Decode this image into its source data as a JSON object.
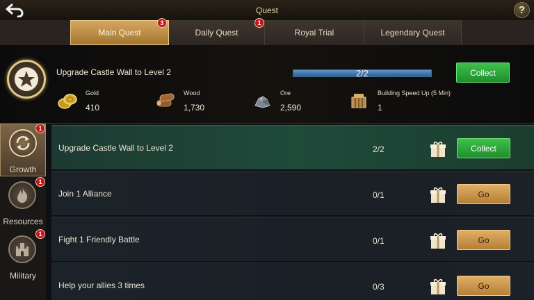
{
  "header": {
    "title": "Quest",
    "help": "?"
  },
  "tabs": [
    {
      "label": "Main Quest",
      "badge": "3",
      "active": true
    },
    {
      "label": "Daily Quest",
      "badge": "1",
      "active": false
    },
    {
      "label": "Royal Trial",
      "badge": "",
      "active": false
    },
    {
      "label": "Legendary Quest",
      "badge": "",
      "active": false
    }
  ],
  "summary": {
    "title": "Upgrade Castle Wall to Level 2",
    "progress_text": "2/2",
    "progress_fraction": 1.0,
    "collect_label": "Collect",
    "rewards": [
      {
        "name": "Gold",
        "value": "410",
        "icon": "gold-coins-icon"
      },
      {
        "name": "Wood",
        "value": "1,730",
        "icon": "wood-logs-icon"
      },
      {
        "name": "Ore",
        "value": "2,590",
        "icon": "ore-icon"
      },
      {
        "name": "Building Speed Up (5 Min)",
        "value": "1",
        "icon": "building-speedup-icon"
      }
    ]
  },
  "sidenav": [
    {
      "label": "Growth",
      "badge": "1",
      "icon": "growth-cycle-icon",
      "active": true
    },
    {
      "label": "Resources",
      "badge": "1",
      "icon": "flame-icon",
      "active": false
    },
    {
      "label": "Military",
      "badge": "1",
      "icon": "castle-icon",
      "active": false
    }
  ],
  "quests": [
    {
      "title": "Upgrade Castle Wall to Level 2",
      "progress": "2/2",
      "action": "Collect",
      "complete": true
    },
    {
      "title": "Join 1 Alliance",
      "progress": "0/1",
      "action": "Go",
      "complete": false
    },
    {
      "title": "Fight 1 Friendly Battle",
      "progress": "0/1",
      "action": "Go",
      "complete": false
    },
    {
      "title": "Help your allies 3 times",
      "progress": "0/3",
      "action": "Go",
      "complete": false
    }
  ],
  "colors": {
    "accent_gold": "#d6a760",
    "collect_green": "#2aa83a",
    "badge_red": "#c0171c"
  }
}
